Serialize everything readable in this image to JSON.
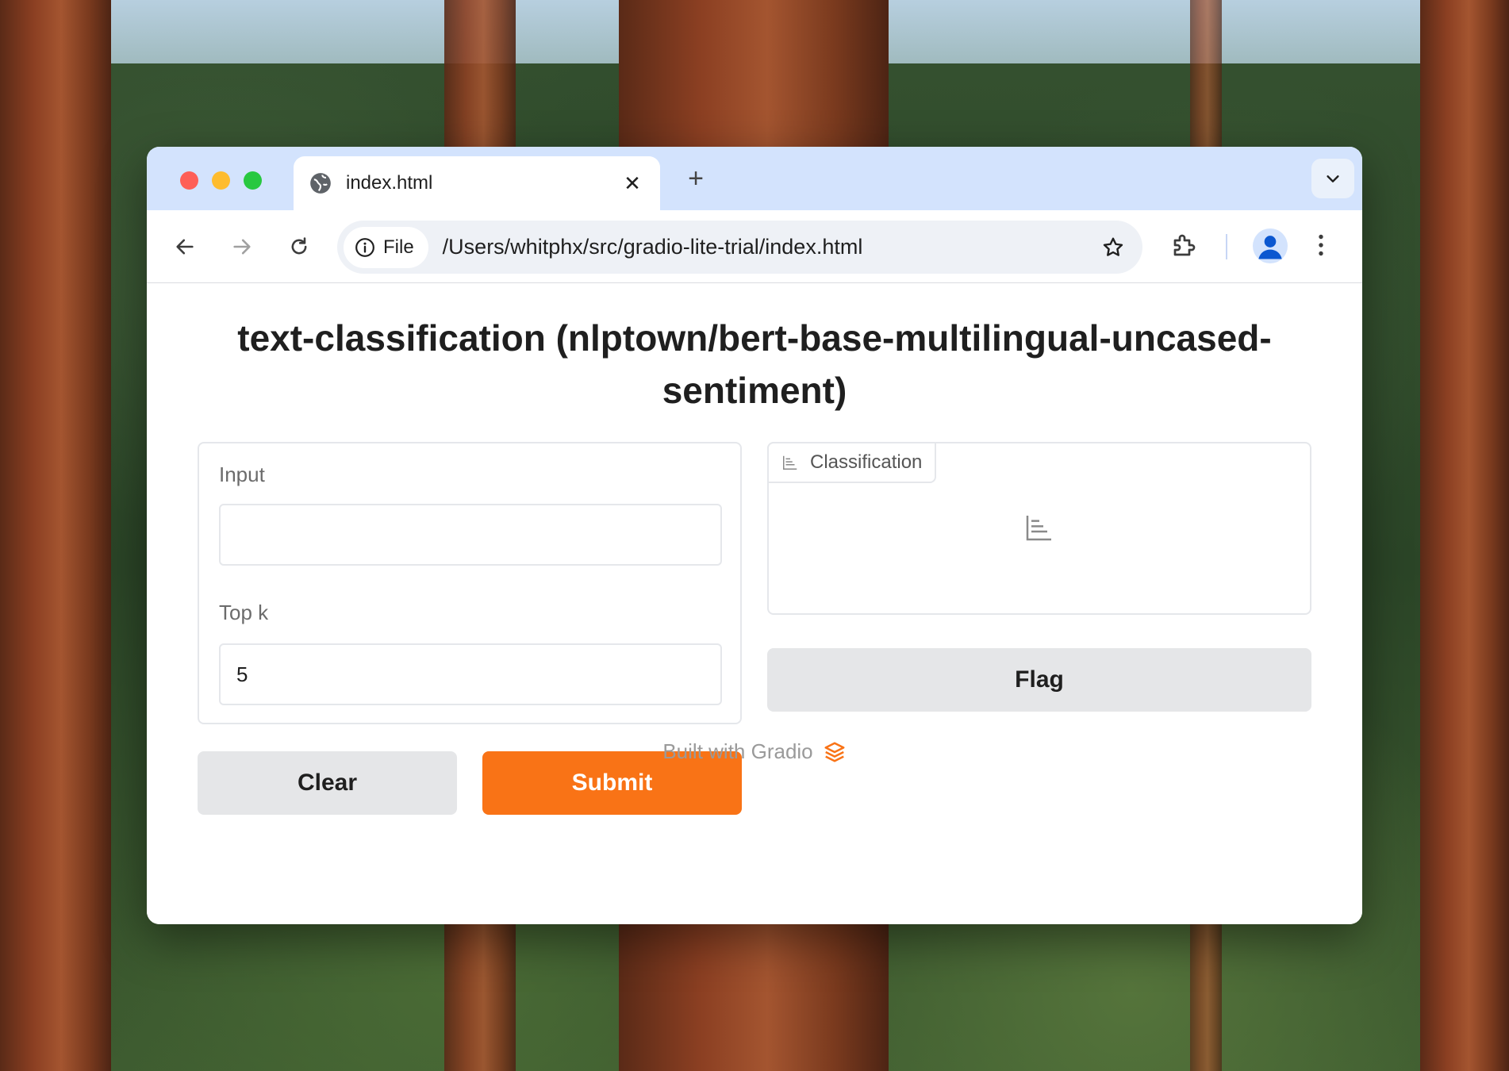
{
  "browser": {
    "tab_title": "index.html",
    "new_tab_symbol": "+",
    "address_chip": "File",
    "url": "/Users/whitphx/src/gradio-lite-trial/index.html"
  },
  "page": {
    "title": "text-classification (nlptown/bert-base-multilingual-uncased-sentiment)",
    "input": {
      "label": "Input",
      "value": ""
    },
    "topk": {
      "label": "Top k",
      "value": "5"
    },
    "buttons": {
      "clear": "Clear",
      "submit": "Submit",
      "flag": "Flag"
    },
    "output": {
      "label": "Classification"
    },
    "footer": "Built with Gradio"
  },
  "colors": {
    "accent": "#f97316",
    "tabbar": "#d3e3fd"
  }
}
